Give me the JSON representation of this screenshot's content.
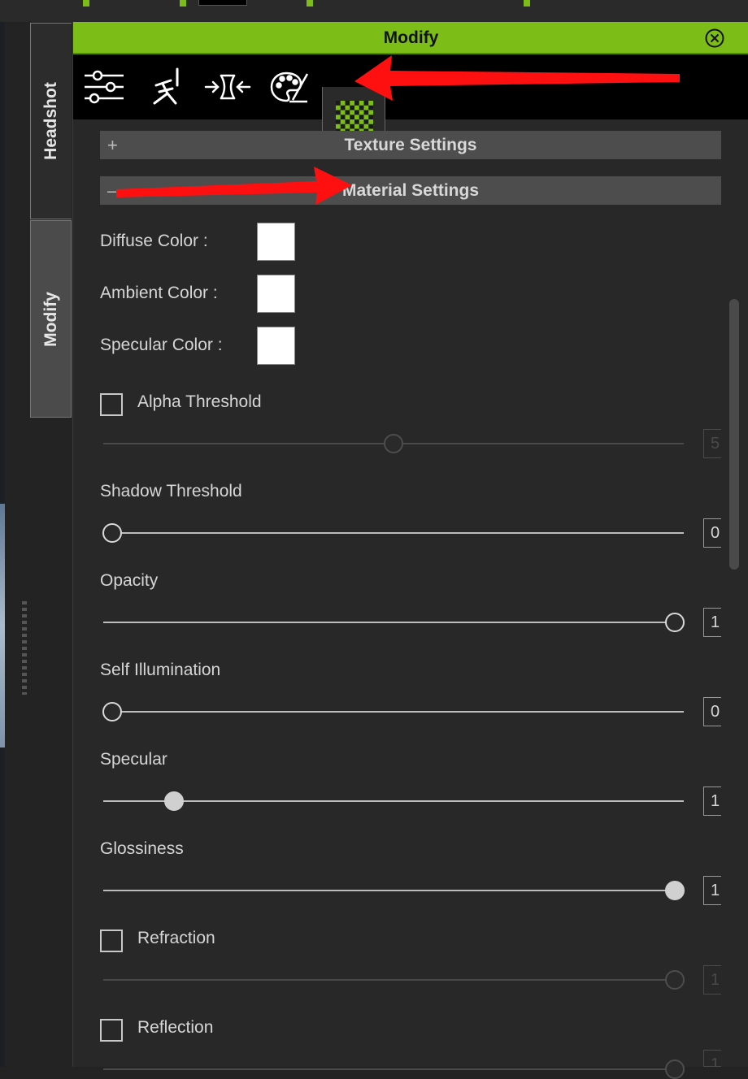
{
  "colors": {
    "accent": "#7dbd17",
    "annotation_arrow": "#ff1010"
  },
  "side_tabs": {
    "headshot": "Headshot",
    "modify": "Modify"
  },
  "panel": {
    "title": "Modify",
    "toolbar_icons": [
      "sliders-icon",
      "figure-edit-icon",
      "morph-arrows-icon",
      "palette-icon",
      "checker-material-icon"
    ],
    "active_tool": "checker-material-icon"
  },
  "sections": {
    "texture": {
      "sign": "+",
      "label": "Texture Settings"
    },
    "material": {
      "sign": "–",
      "label": "Material Settings"
    }
  },
  "colors_block": {
    "diffuse": {
      "label": "Diffuse Color :",
      "value": "#ffffff"
    },
    "ambient": {
      "label": "Ambient Color :",
      "value": "#ffffff"
    },
    "specular": {
      "label": "Specular Color :",
      "value": "#ffffff"
    }
  },
  "sliders": {
    "alpha_threshold": {
      "label": "Alpha Threshold",
      "has_checkbox": true,
      "checked": false,
      "enabled": false,
      "value": "5",
      "fraction": 0.5
    },
    "shadow_threshold": {
      "label": "Shadow Threshold",
      "enabled": true,
      "value": "0",
      "fraction": 0.0
    },
    "opacity": {
      "label": "Opacity",
      "enabled": true,
      "value": "1",
      "fraction": 1.0
    },
    "self_illumination": {
      "label": "Self Illumination",
      "enabled": true,
      "value": "0",
      "fraction": 0.0
    },
    "specular": {
      "label": "Specular",
      "enabled": true,
      "value": "1",
      "fraction": 0.11
    },
    "glossiness": {
      "label": "Glossiness",
      "enabled": true,
      "value": "1",
      "fraction": 1.0
    },
    "refraction": {
      "label": "Refraction",
      "has_checkbox": true,
      "checked": false,
      "enabled": false,
      "value": "1",
      "fraction": 1.0
    },
    "reflection": {
      "label": "Reflection",
      "has_checkbox": true,
      "checked": false,
      "enabled": false,
      "value": "1",
      "fraction": 1.0
    }
  }
}
